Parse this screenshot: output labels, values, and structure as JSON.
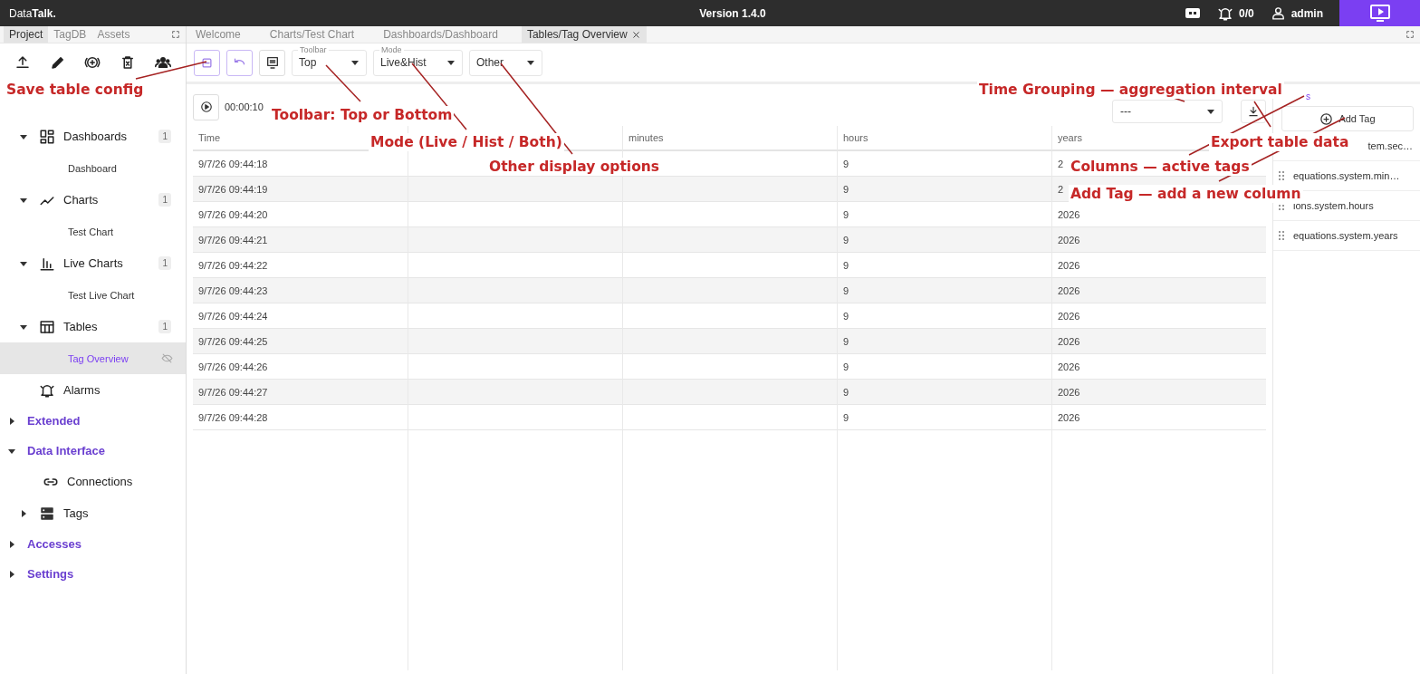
{
  "header": {
    "brand": "Data**Talk.**",
    "version": "Version 1.4.0",
    "alarm_count": "0/0",
    "user": "admin"
  },
  "sidebar": {
    "tabs": [
      {
        "label": "Project",
        "selected": true
      },
      {
        "label": "TagDB",
        "selected": false
      },
      {
        "label": "Assets",
        "selected": false
      }
    ],
    "tree": [
      {
        "label": "Dashboards",
        "count": "1",
        "expanded": true,
        "children": [
          {
            "label": "Dashboard",
            "selected": false
          }
        ]
      },
      {
        "label": "Charts",
        "count": "1",
        "expanded": true,
        "children": [
          {
            "label": "Test Chart",
            "selected": false
          }
        ]
      },
      {
        "label": "Live Charts",
        "count": "1",
        "expanded": true,
        "children": [
          {
            "label": "Test Live Chart",
            "selected": false
          }
        ]
      },
      {
        "label": "Tables",
        "count": "1",
        "expanded": true,
        "children": [
          {
            "label": "Tag Overview",
            "selected": true
          }
        ]
      },
      {
        "label": "Alarms"
      }
    ],
    "sections": [
      {
        "label": "Extended",
        "expanded": false
      },
      {
        "label": "Data Interface",
        "expanded": true,
        "children": [
          {
            "label": "Connections"
          },
          {
            "label": "Tags",
            "expanded": false
          }
        ]
      },
      {
        "label": "Accesses",
        "expanded": false
      },
      {
        "label": "Settings",
        "expanded": false
      }
    ]
  },
  "editor_tabs": [
    {
      "label": "Welcome",
      "selected": false
    },
    {
      "label": "Charts/Test Chart",
      "selected": false
    },
    {
      "label": "Dashboards/Dashboard",
      "selected": false
    },
    {
      "label": "Tables/Tag Overview",
      "selected": true
    }
  ],
  "toolbar": {
    "selects": [
      {
        "label": "Toolbar",
        "value": "Top"
      },
      {
        "label": "Mode",
        "value": "Live&Hist"
      },
      {
        "value": "Other"
      }
    ]
  },
  "timer": "00:00:10",
  "grouping": {
    "value": "---"
  },
  "table": {
    "columns": [
      "Time",
      null,
      "minutes",
      "hours",
      "years"
    ],
    "rows": [
      [
        "9/7/26 09:44:18",
        null,
        null,
        "9",
        "2"
      ],
      [
        "9/7/26 09:44:19",
        null,
        null,
        "9",
        "2"
      ],
      [
        "9/7/26 09:44:20",
        null,
        null,
        "9",
        "2026"
      ],
      [
        "9/7/26 09:44:21",
        null,
        null,
        "9",
        "2026"
      ],
      [
        "9/7/26 09:44:22",
        null,
        null,
        "9",
        "2026"
      ],
      [
        "9/7/26 09:44:23",
        null,
        null,
        "9",
        "2026"
      ],
      [
        "9/7/26 09:44:24",
        null,
        null,
        "9",
        "2026"
      ],
      [
        "9/7/26 09:44:25",
        null,
        null,
        "9",
        "2026"
      ],
      [
        "9/7/26 09:44:26",
        null,
        null,
        "9",
        "2026"
      ],
      [
        "9/7/26 09:44:27",
        null,
        null,
        "9",
        "2026"
      ],
      [
        "9/7/26 09:44:28",
        null,
        null,
        "9",
        "2026"
      ]
    ]
  },
  "columns_panel": {
    "link": "s",
    "add_button": "Add Tag",
    "tags": [
      "tem.sec…",
      "equations.system.min…",
      "ions.system.hours",
      "equations.system.years"
    ]
  },
  "annotations": [
    "Save table config",
    "Toolbar: Top or Bottom",
    "Mode (Live / Hist / Both)",
    "Other display options",
    "Time Grouping — aggregation interval",
    "Export table data",
    "Columns — active tags",
    "Add Tag — add a new column"
  ]
}
